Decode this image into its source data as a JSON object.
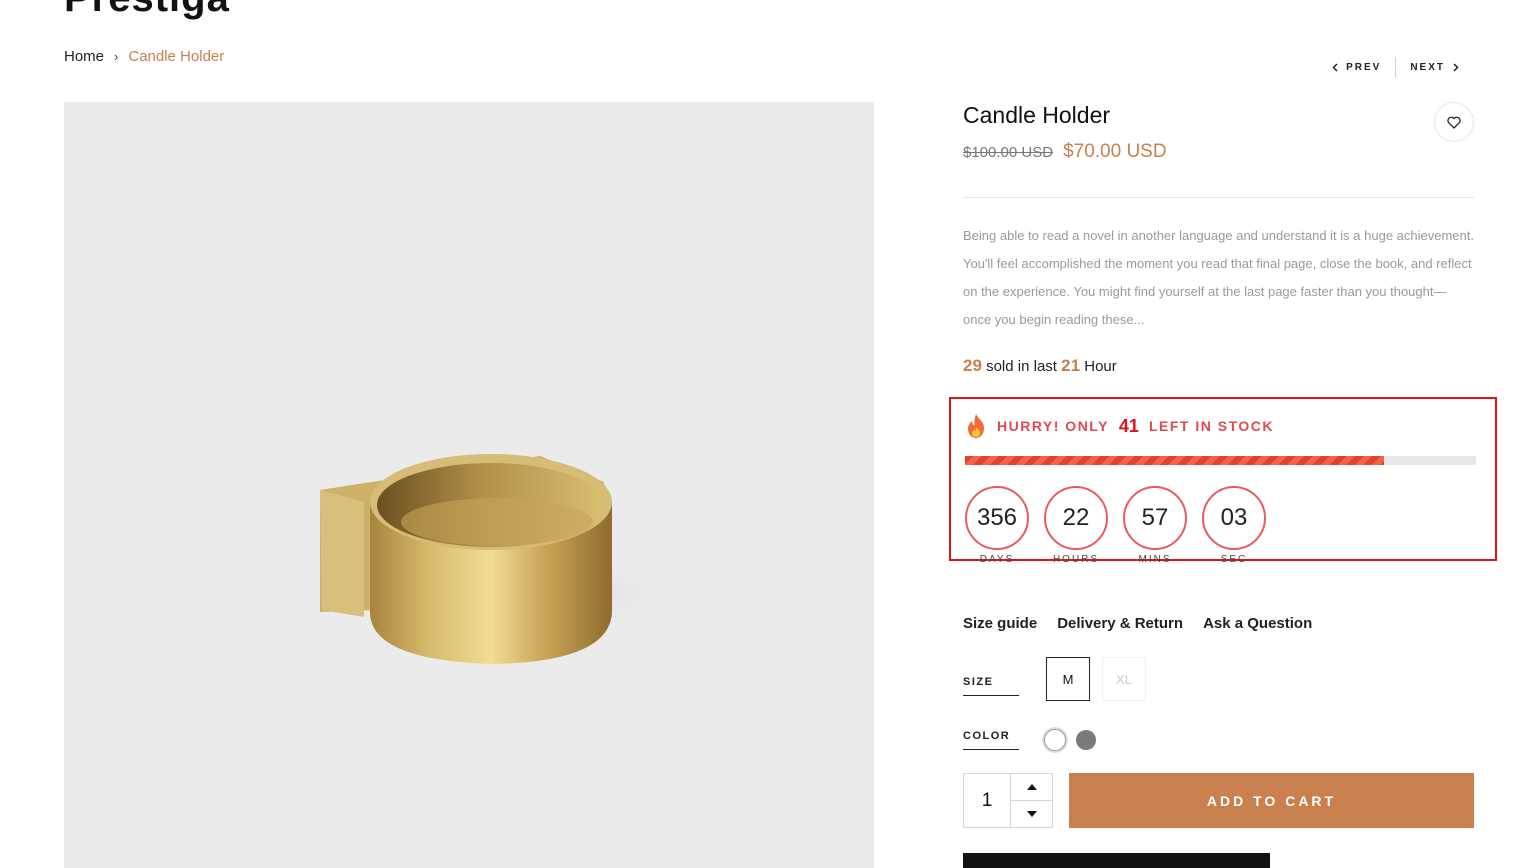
{
  "site": {
    "title": "Prestiga"
  },
  "breadcrumb": {
    "home": "Home",
    "separator": "›",
    "current": "Candle Holder"
  },
  "pager": {
    "prev": "PREV",
    "next": "NEXT"
  },
  "product": {
    "title": "Candle Holder",
    "price_old": "$100.00 USD",
    "price_new": "$70.00 USD",
    "description": "Being able to read a novel in another language and understand it is a huge achievement. You'll feel accomplished the moment you read that final page, close the book, and reflect on the experience. You might find yourself at the last page faster than you thought—once you begin reading these...",
    "image_alt": "brass candle holder"
  },
  "sold": {
    "count": "29",
    "text_mid": "sold in last",
    "hours": "21",
    "text_end": "Hour"
  },
  "stock": {
    "prefix": "HURRY! ONLY",
    "count": "41",
    "suffix": "LEFT IN STOCK",
    "fill_fraction": 0.82
  },
  "countdown": [
    {
      "value": "356",
      "label": "DAYS"
    },
    {
      "value": "22",
      "label": "HOURS"
    },
    {
      "value": "57",
      "label": "MINS"
    },
    {
      "value": "03",
      "label": "SEC"
    }
  ],
  "links": {
    "size_guide": "Size guide",
    "delivery": "Delivery & Return",
    "ask": "Ask a Question"
  },
  "options": {
    "size_label": "SIZE",
    "sizes": [
      "M",
      "XL"
    ],
    "color_label": "COLOR",
    "colors": [
      "#ffffff",
      "#7a7a7a"
    ]
  },
  "cart": {
    "quantity": "1",
    "add_label": "ADD TO CART"
  },
  "colors": {
    "accent": "#c8804f",
    "urgent": "#e0121b"
  }
}
